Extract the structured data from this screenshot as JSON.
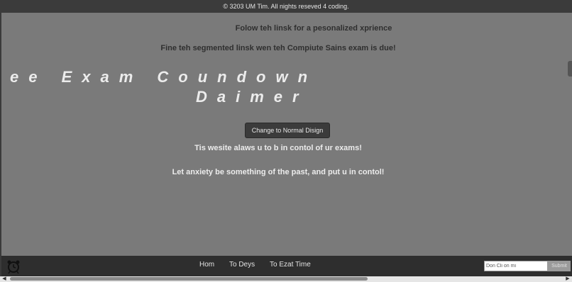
{
  "footer_top": {
    "copyright": "© 3203 UM Tim. All nights reseved 4 coding."
  },
  "main": {
    "link_line_1": "Folow teh linsk for a pesonalized xprience",
    "link_line_2": "Fine teh segmented linsk wen teh Compiute Sains exam is due!",
    "title_line_1": "ee Exam Coundown",
    "title_line_2": "Daimer",
    "design_button_label": "Change to Normal Disign",
    "body_line_1": "Tis wesite alaws u to b in contol of ur exams!",
    "body_line_2": "Let anxiety be something of the past, and put u in contol!"
  },
  "navbar": {
    "items": [
      {
        "label": "Hom"
      },
      {
        "label": "To Deys"
      },
      {
        "label": "To Ezat Time"
      }
    ],
    "search": {
      "value": "Don Cli on mi",
      "placeholder": "Don Cli on mi"
    },
    "submit_label": "Submit"
  },
  "icons": {
    "alarm": "alarm-clock-icon",
    "scroll_left": "arrow-left-icon",
    "scroll_right": "arrow-right-icon"
  },
  "colors": {
    "background": "#7a7a7a",
    "bars": "#2e2e2e",
    "heading_text": "#ececec",
    "link_text": "#2f2f2f"
  }
}
